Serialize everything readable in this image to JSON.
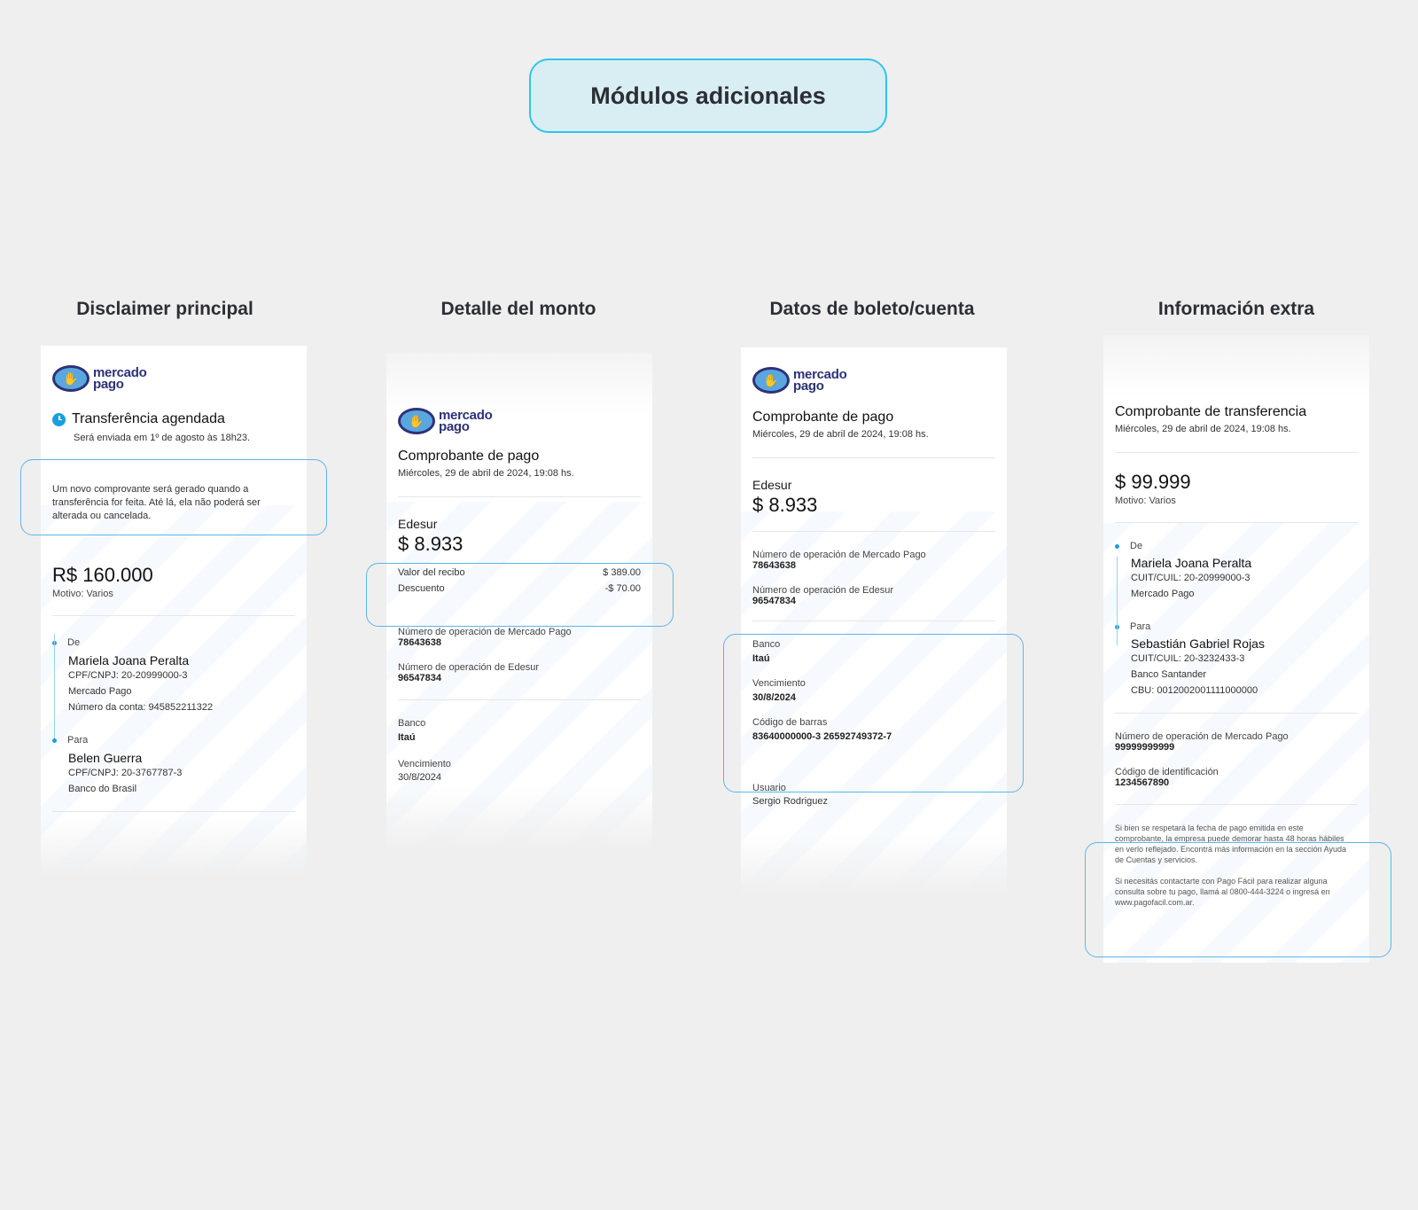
{
  "title": "Módulos adicionales",
  "columns": [
    {
      "heading": "Disclaimer principal"
    },
    {
      "heading": "Detalle del monto"
    },
    {
      "heading": "Datos de boleto/cuenta"
    },
    {
      "heading": "Información extra"
    }
  ],
  "logo": {
    "line1": "mercado",
    "line2": "pago"
  },
  "card1": {
    "status_title": "Transferência agendada",
    "status_sub": "Será enviada em 1º de agosto às 18h23.",
    "disclaimer": "Um novo comprovante será gerado quando a transferência for feita. Até lá, ela não poderá ser alterada ou cancelada.",
    "amount": "R$ 160.000",
    "motivo": "Motivo: Varios",
    "from_label": "De",
    "from_name": "Mariela Joana Peralta",
    "from_lines": [
      "CPF/CNPJ: 20-20999000-3",
      "Mercado Pago",
      "Número da conta: 945852211322"
    ],
    "to_label": "Para",
    "to_name": "Belen Guerra",
    "to_lines": [
      "CPF/CNPJ: 20-3767787-3",
      "Banco do Brasil"
    ]
  },
  "card2": {
    "title": "Comprobante de pago",
    "date": "Miércoles, 29 de abril de 2024, 19:08 hs.",
    "company": "Edesur",
    "amount": "$ 8.933",
    "detail": [
      {
        "label": "Valor del recibo",
        "value": "$ 389.00"
      },
      {
        "label": "Descuento",
        "value": "-$ 70.00"
      }
    ],
    "op_mp_label": "Número de operación de Mercado Pago",
    "op_mp_value": "78643638",
    "op_edesur_label": "Número de operación de Edesur",
    "op_edesur_value": "96547834",
    "bank_label": "Banco",
    "bank_value": "Itaú",
    "due_label": "Vencimiento",
    "due_value": "30/8/2024"
  },
  "card3": {
    "title": "Comprobante de pago",
    "date": "Miércoles, 29 de abril de 2024, 19:08 hs.",
    "company": "Edesur",
    "amount": "$ 8.933",
    "op_mp_label": "Número de operación de Mercado Pago",
    "op_mp_value": "78643638",
    "op_edesur_label": "Número de operación de Edesur",
    "op_edesur_value": "96547834",
    "bank_label": "Banco",
    "bank_value": "Itaú",
    "due_label": "Vencimiento",
    "due_value": "30/8/2024",
    "barcode_label": "Código de barras",
    "barcode_value": "83640000000-3 26592749372-7",
    "user_label": "Usuario",
    "user_value": "Sergio Rodriguez"
  },
  "card4": {
    "title": "Comprobante de transferencia",
    "date": "Miércoles, 29 de abril de 2024, 19:08 hs.",
    "amount": "$ 99.999",
    "motivo": "Motivo: Varios",
    "from_label": "De",
    "from_name": "Mariela Joana Peralta",
    "from_lines": [
      "CUIT/CUIL: 20-20999000-3",
      "Mercado Pago"
    ],
    "to_label": "Para",
    "to_name": "Sebastián Gabriel Rojas",
    "to_lines": [
      "CUIT/CUIL: 20-3232433-3",
      "Banco Santander",
      "CBU: 0012002001111000000"
    ],
    "op_mp_label": "Número de operación de Mercado Pago",
    "op_mp_value": "99999999999",
    "id_label": "Código de identificación",
    "id_value": "1234567890",
    "extra_1": "Si bien se respetará la fecha de pago emitida en este comprobante, la empresa puede demorar hasta 48 horas hábiles en verlo reflejado. Encontrá más información en la sección Ayuda de Cuentas y servicios.",
    "extra_2": "Si necesitás contactarte con Pago Fácil para realizar alguna consulta sobre tu pago, llamá al 0800-444-3224 o ingresá en www.pagofacil.com.ar."
  },
  "colors": {
    "accent": "#2ec4ec",
    "highlight": "#5cb6ea",
    "brand": "#2d3277",
    "background": "#efefef"
  },
  "icons": [
    "handshake-logo-icon",
    "clock-icon"
  ]
}
